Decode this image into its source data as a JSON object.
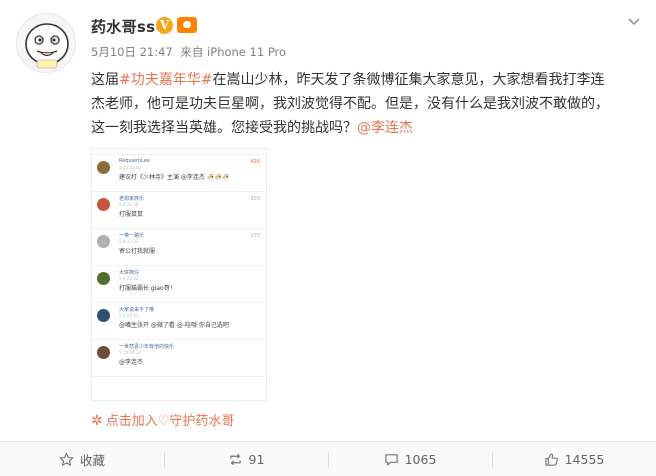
{
  "post": {
    "author": "药水哥ss",
    "verified_badge": "V",
    "meta_date": "5月10日 21:47",
    "meta_source": "来自 iPhone 11 Pro",
    "text_prefix": "这届",
    "hashtag": "#功夫嘉年华#",
    "text_body": "在嵩山少林，昨天发了条微博征集大家意见，大家想看我打李连杰老师，他可是功夫巨星啊，我刘波觉得不配。但是，没有什么是我刘波不敢做的，这一刻我选择当英雄。您接受我的挑战吗？",
    "mention": "@李连杰",
    "support_link": "点击加入♡守护药水哥",
    "avatar_text": "药水哥"
  },
  "image_comments": [
    {
      "name": "RequiemLee",
      "time": "5-10 21:00",
      "text": "建议打《少林寺》主演 @李连杰 🍜🍜🍜",
      "link": "",
      "likes": "426",
      "hot": true,
      "avatar_color": "#8a6d3b"
    },
    {
      "name": "老狗家族乐",
      "time": "5-9 22:30",
      "text": "打服鼠鼠",
      "link": "",
      "likes": "303",
      "hot": false,
      "avatar_color": "#c8553d"
    },
    {
      "name": "一带一路乐",
      "time": "5-9 22:31",
      "text": "寄公打我就服",
      "link": "",
      "likes": "177",
      "hot": false,
      "avatar_color": "#b0b0b0"
    },
    {
      "name": "大饼熊仔",
      "time": "5-9 22:32",
      "text": "打服猫霸长 giao哥！",
      "link": "",
      "likes": "",
      "hot": false,
      "avatar_color": "#556b2f"
    },
    {
      "name": "大家说来不了哦",
      "time": "5-9 22:33",
      "text": "@嘴生张开 @微了看 @-哇哦·你自己选吧",
      "link": "",
      "likes": "",
      "hot": false,
      "avatar_color": "#2f4f6f"
    },
    {
      "name": "一世悲喜少年有他的快乐",
      "time": "5-10 09:12",
      "text": "@李连杰",
      "link": "",
      "likes": "",
      "hot": false,
      "avatar_color": "#6b4e3d"
    }
  ],
  "actions": [
    {
      "label": "收藏",
      "icon": "star-icon"
    },
    {
      "label": "91",
      "icon": "repost-icon"
    },
    {
      "label": "1065",
      "icon": "comment-icon"
    },
    {
      "label": "14555",
      "icon": "like-icon"
    }
  ],
  "colors": {
    "link": "#eb7350",
    "verified": "#f7a51c",
    "text": "#333333",
    "meta": "#808080"
  }
}
